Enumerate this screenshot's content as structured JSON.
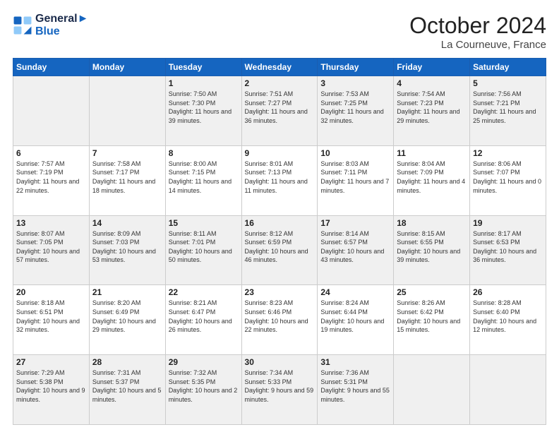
{
  "header": {
    "logo_line1": "General",
    "logo_line2": "Blue",
    "month": "October 2024",
    "location": "La Courneuve, France"
  },
  "weekdays": [
    "Sunday",
    "Monday",
    "Tuesday",
    "Wednesday",
    "Thursday",
    "Friday",
    "Saturday"
  ],
  "weeks": [
    [
      {
        "day": "",
        "info": ""
      },
      {
        "day": "",
        "info": ""
      },
      {
        "day": "1",
        "info": "Sunrise: 7:50 AM\nSunset: 7:30 PM\nDaylight: 11 hours and 39 minutes."
      },
      {
        "day": "2",
        "info": "Sunrise: 7:51 AM\nSunset: 7:27 PM\nDaylight: 11 hours and 36 minutes."
      },
      {
        "day": "3",
        "info": "Sunrise: 7:53 AM\nSunset: 7:25 PM\nDaylight: 11 hours and 32 minutes."
      },
      {
        "day": "4",
        "info": "Sunrise: 7:54 AM\nSunset: 7:23 PM\nDaylight: 11 hours and 29 minutes."
      },
      {
        "day": "5",
        "info": "Sunrise: 7:56 AM\nSunset: 7:21 PM\nDaylight: 11 hours and 25 minutes."
      }
    ],
    [
      {
        "day": "6",
        "info": "Sunrise: 7:57 AM\nSunset: 7:19 PM\nDaylight: 11 hours and 22 minutes."
      },
      {
        "day": "7",
        "info": "Sunrise: 7:58 AM\nSunset: 7:17 PM\nDaylight: 11 hours and 18 minutes."
      },
      {
        "day": "8",
        "info": "Sunrise: 8:00 AM\nSunset: 7:15 PM\nDaylight: 11 hours and 14 minutes."
      },
      {
        "day": "9",
        "info": "Sunrise: 8:01 AM\nSunset: 7:13 PM\nDaylight: 11 hours and 11 minutes."
      },
      {
        "day": "10",
        "info": "Sunrise: 8:03 AM\nSunset: 7:11 PM\nDaylight: 11 hours and 7 minutes."
      },
      {
        "day": "11",
        "info": "Sunrise: 8:04 AM\nSunset: 7:09 PM\nDaylight: 11 hours and 4 minutes."
      },
      {
        "day": "12",
        "info": "Sunrise: 8:06 AM\nSunset: 7:07 PM\nDaylight: 11 hours and 0 minutes."
      }
    ],
    [
      {
        "day": "13",
        "info": "Sunrise: 8:07 AM\nSunset: 7:05 PM\nDaylight: 10 hours and 57 minutes."
      },
      {
        "day": "14",
        "info": "Sunrise: 8:09 AM\nSunset: 7:03 PM\nDaylight: 10 hours and 53 minutes."
      },
      {
        "day": "15",
        "info": "Sunrise: 8:11 AM\nSunset: 7:01 PM\nDaylight: 10 hours and 50 minutes."
      },
      {
        "day": "16",
        "info": "Sunrise: 8:12 AM\nSunset: 6:59 PM\nDaylight: 10 hours and 46 minutes."
      },
      {
        "day": "17",
        "info": "Sunrise: 8:14 AM\nSunset: 6:57 PM\nDaylight: 10 hours and 43 minutes."
      },
      {
        "day": "18",
        "info": "Sunrise: 8:15 AM\nSunset: 6:55 PM\nDaylight: 10 hours and 39 minutes."
      },
      {
        "day": "19",
        "info": "Sunrise: 8:17 AM\nSunset: 6:53 PM\nDaylight: 10 hours and 36 minutes."
      }
    ],
    [
      {
        "day": "20",
        "info": "Sunrise: 8:18 AM\nSunset: 6:51 PM\nDaylight: 10 hours and 32 minutes."
      },
      {
        "day": "21",
        "info": "Sunrise: 8:20 AM\nSunset: 6:49 PM\nDaylight: 10 hours and 29 minutes."
      },
      {
        "day": "22",
        "info": "Sunrise: 8:21 AM\nSunset: 6:47 PM\nDaylight: 10 hours and 26 minutes."
      },
      {
        "day": "23",
        "info": "Sunrise: 8:23 AM\nSunset: 6:46 PM\nDaylight: 10 hours and 22 minutes."
      },
      {
        "day": "24",
        "info": "Sunrise: 8:24 AM\nSunset: 6:44 PM\nDaylight: 10 hours and 19 minutes."
      },
      {
        "day": "25",
        "info": "Sunrise: 8:26 AM\nSunset: 6:42 PM\nDaylight: 10 hours and 15 minutes."
      },
      {
        "day": "26",
        "info": "Sunrise: 8:28 AM\nSunset: 6:40 PM\nDaylight: 10 hours and 12 minutes."
      }
    ],
    [
      {
        "day": "27",
        "info": "Sunrise: 7:29 AM\nSunset: 5:38 PM\nDaylight: 10 hours and 9 minutes."
      },
      {
        "day": "28",
        "info": "Sunrise: 7:31 AM\nSunset: 5:37 PM\nDaylight: 10 hours and 5 minutes."
      },
      {
        "day": "29",
        "info": "Sunrise: 7:32 AM\nSunset: 5:35 PM\nDaylight: 10 hours and 2 minutes."
      },
      {
        "day": "30",
        "info": "Sunrise: 7:34 AM\nSunset: 5:33 PM\nDaylight: 9 hours and 59 minutes."
      },
      {
        "day": "31",
        "info": "Sunrise: 7:36 AM\nSunset: 5:31 PM\nDaylight: 9 hours and 55 minutes."
      },
      {
        "day": "",
        "info": ""
      },
      {
        "day": "",
        "info": ""
      }
    ]
  ]
}
